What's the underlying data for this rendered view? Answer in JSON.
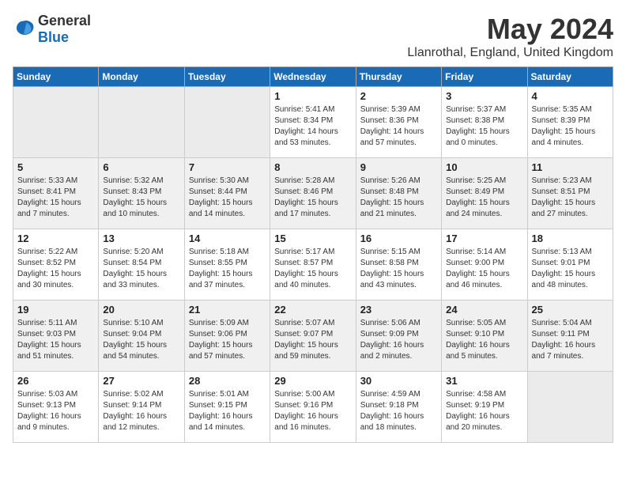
{
  "logo": {
    "general": "General",
    "blue": "Blue"
  },
  "title": "May 2024",
  "location": "Llanrothal, England, United Kingdom",
  "headers": [
    "Sunday",
    "Monday",
    "Tuesday",
    "Wednesday",
    "Thursday",
    "Friday",
    "Saturday"
  ],
  "weeks": [
    [
      {
        "day": "",
        "empty": true
      },
      {
        "day": "",
        "empty": true
      },
      {
        "day": "",
        "empty": true
      },
      {
        "day": "1",
        "sunrise": "Sunrise: 5:41 AM",
        "sunset": "Sunset: 8:34 PM",
        "daylight": "Daylight: 14 hours and 53 minutes."
      },
      {
        "day": "2",
        "sunrise": "Sunrise: 5:39 AM",
        "sunset": "Sunset: 8:36 PM",
        "daylight": "Daylight: 14 hours and 57 minutes."
      },
      {
        "day": "3",
        "sunrise": "Sunrise: 5:37 AM",
        "sunset": "Sunset: 8:38 PM",
        "daylight": "Daylight: 15 hours and 0 minutes."
      },
      {
        "day": "4",
        "sunrise": "Sunrise: 5:35 AM",
        "sunset": "Sunset: 8:39 PM",
        "daylight": "Daylight: 15 hours and 4 minutes."
      }
    ],
    [
      {
        "day": "5",
        "sunrise": "Sunrise: 5:33 AM",
        "sunset": "Sunset: 8:41 PM",
        "daylight": "Daylight: 15 hours and 7 minutes."
      },
      {
        "day": "6",
        "sunrise": "Sunrise: 5:32 AM",
        "sunset": "Sunset: 8:43 PM",
        "daylight": "Daylight: 15 hours and 10 minutes."
      },
      {
        "day": "7",
        "sunrise": "Sunrise: 5:30 AM",
        "sunset": "Sunset: 8:44 PM",
        "daylight": "Daylight: 15 hours and 14 minutes."
      },
      {
        "day": "8",
        "sunrise": "Sunrise: 5:28 AM",
        "sunset": "Sunset: 8:46 PM",
        "daylight": "Daylight: 15 hours and 17 minutes."
      },
      {
        "day": "9",
        "sunrise": "Sunrise: 5:26 AM",
        "sunset": "Sunset: 8:48 PM",
        "daylight": "Daylight: 15 hours and 21 minutes."
      },
      {
        "day": "10",
        "sunrise": "Sunrise: 5:25 AM",
        "sunset": "Sunset: 8:49 PM",
        "daylight": "Daylight: 15 hours and 24 minutes."
      },
      {
        "day": "11",
        "sunrise": "Sunrise: 5:23 AM",
        "sunset": "Sunset: 8:51 PM",
        "daylight": "Daylight: 15 hours and 27 minutes."
      }
    ],
    [
      {
        "day": "12",
        "sunrise": "Sunrise: 5:22 AM",
        "sunset": "Sunset: 8:52 PM",
        "daylight": "Daylight: 15 hours and 30 minutes."
      },
      {
        "day": "13",
        "sunrise": "Sunrise: 5:20 AM",
        "sunset": "Sunset: 8:54 PM",
        "daylight": "Daylight: 15 hours and 33 minutes."
      },
      {
        "day": "14",
        "sunrise": "Sunrise: 5:18 AM",
        "sunset": "Sunset: 8:55 PM",
        "daylight": "Daylight: 15 hours and 37 minutes."
      },
      {
        "day": "15",
        "sunrise": "Sunrise: 5:17 AM",
        "sunset": "Sunset: 8:57 PM",
        "daylight": "Daylight: 15 hours and 40 minutes."
      },
      {
        "day": "16",
        "sunrise": "Sunrise: 5:15 AM",
        "sunset": "Sunset: 8:58 PM",
        "daylight": "Daylight: 15 hours and 43 minutes."
      },
      {
        "day": "17",
        "sunrise": "Sunrise: 5:14 AM",
        "sunset": "Sunset: 9:00 PM",
        "daylight": "Daylight: 15 hours and 46 minutes."
      },
      {
        "day": "18",
        "sunrise": "Sunrise: 5:13 AM",
        "sunset": "Sunset: 9:01 PM",
        "daylight": "Daylight: 15 hours and 48 minutes."
      }
    ],
    [
      {
        "day": "19",
        "sunrise": "Sunrise: 5:11 AM",
        "sunset": "Sunset: 9:03 PM",
        "daylight": "Daylight: 15 hours and 51 minutes."
      },
      {
        "day": "20",
        "sunrise": "Sunrise: 5:10 AM",
        "sunset": "Sunset: 9:04 PM",
        "daylight": "Daylight: 15 hours and 54 minutes."
      },
      {
        "day": "21",
        "sunrise": "Sunrise: 5:09 AM",
        "sunset": "Sunset: 9:06 PM",
        "daylight": "Daylight: 15 hours and 57 minutes."
      },
      {
        "day": "22",
        "sunrise": "Sunrise: 5:07 AM",
        "sunset": "Sunset: 9:07 PM",
        "daylight": "Daylight: 15 hours and 59 minutes."
      },
      {
        "day": "23",
        "sunrise": "Sunrise: 5:06 AM",
        "sunset": "Sunset: 9:09 PM",
        "daylight": "Daylight: 16 hours and 2 minutes."
      },
      {
        "day": "24",
        "sunrise": "Sunrise: 5:05 AM",
        "sunset": "Sunset: 9:10 PM",
        "daylight": "Daylight: 16 hours and 5 minutes."
      },
      {
        "day": "25",
        "sunrise": "Sunrise: 5:04 AM",
        "sunset": "Sunset: 9:11 PM",
        "daylight": "Daylight: 16 hours and 7 minutes."
      }
    ],
    [
      {
        "day": "26",
        "sunrise": "Sunrise: 5:03 AM",
        "sunset": "Sunset: 9:13 PM",
        "daylight": "Daylight: 16 hours and 9 minutes."
      },
      {
        "day": "27",
        "sunrise": "Sunrise: 5:02 AM",
        "sunset": "Sunset: 9:14 PM",
        "daylight": "Daylight: 16 hours and 12 minutes."
      },
      {
        "day": "28",
        "sunrise": "Sunrise: 5:01 AM",
        "sunset": "Sunset: 9:15 PM",
        "daylight": "Daylight: 16 hours and 14 minutes."
      },
      {
        "day": "29",
        "sunrise": "Sunrise: 5:00 AM",
        "sunset": "Sunset: 9:16 PM",
        "daylight": "Daylight: 16 hours and 16 minutes."
      },
      {
        "day": "30",
        "sunrise": "Sunrise: 4:59 AM",
        "sunset": "Sunset: 9:18 PM",
        "daylight": "Daylight: 16 hours and 18 minutes."
      },
      {
        "day": "31",
        "sunrise": "Sunrise: 4:58 AM",
        "sunset": "Sunset: 9:19 PM",
        "daylight": "Daylight: 16 hours and 20 minutes."
      },
      {
        "day": "",
        "empty": true
      }
    ]
  ]
}
